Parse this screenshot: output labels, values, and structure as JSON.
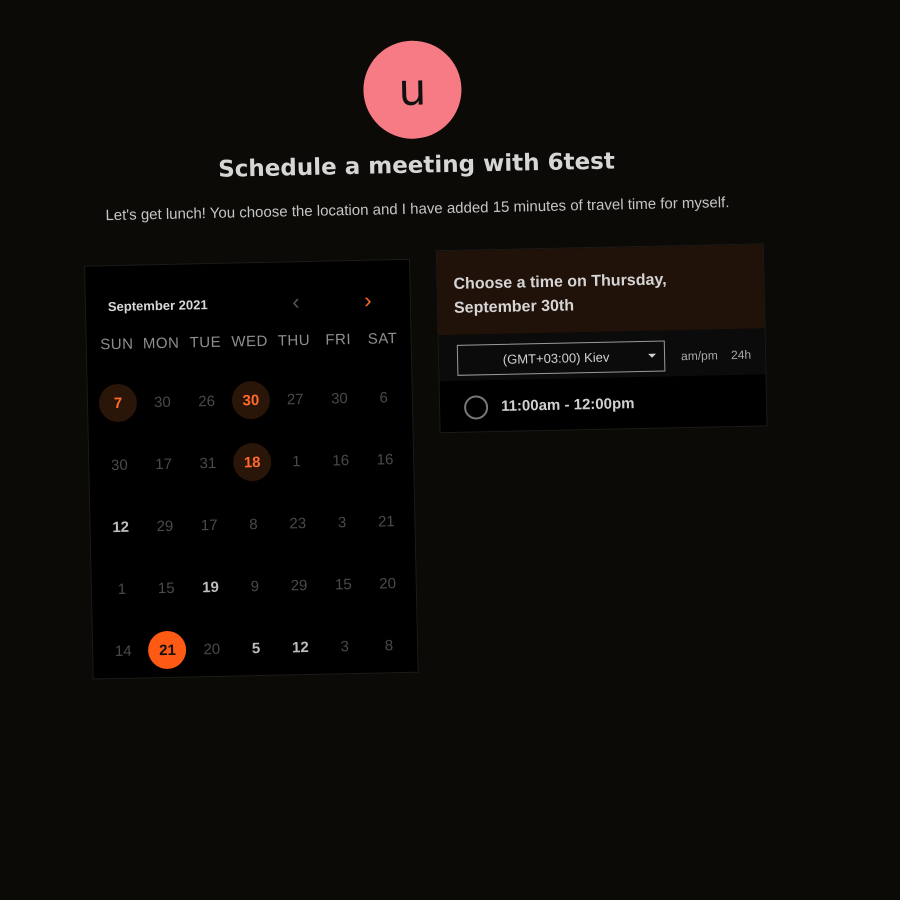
{
  "host": {
    "avatar_letter": "u",
    "avatar_color": "#f77b85"
  },
  "title": "Schedule a meeting with 6test",
  "description": "Let's get lunch! You choose the location and I have added 15 minutes of travel time for myself.",
  "calendar": {
    "month_label": "September 2021",
    "prev_icon": "chevron-left-icon",
    "next_icon": "chevron-right-icon",
    "weekdays": [
      "SUN",
      "MON",
      "TUE",
      "WED",
      "THU",
      "FRI",
      "SAT"
    ],
    "days": [
      {
        "label": "7",
        "state": "available"
      },
      {
        "label": "30",
        "state": "muted"
      },
      {
        "label": "26",
        "state": "muted"
      },
      {
        "label": "30",
        "state": "available"
      },
      {
        "label": "27",
        "state": "muted"
      },
      {
        "label": "30",
        "state": "muted"
      },
      {
        "label": "6",
        "state": "muted"
      },
      {
        "label": "30",
        "state": "muted"
      },
      {
        "label": "17",
        "state": "muted"
      },
      {
        "label": "31",
        "state": "muted"
      },
      {
        "label": "18",
        "state": "available"
      },
      {
        "label": "1",
        "state": "muted"
      },
      {
        "label": "16",
        "state": "muted"
      },
      {
        "label": "16",
        "state": "muted"
      },
      {
        "label": "12",
        "state": "bold"
      },
      {
        "label": "29",
        "state": "muted"
      },
      {
        "label": "17",
        "state": "muted"
      },
      {
        "label": "8",
        "state": "muted"
      },
      {
        "label": "23",
        "state": "muted"
      },
      {
        "label": "3",
        "state": "muted"
      },
      {
        "label": "21",
        "state": "muted"
      },
      {
        "label": "1",
        "state": "muted"
      },
      {
        "label": "15",
        "state": "muted"
      },
      {
        "label": "19",
        "state": "bold"
      },
      {
        "label": "9",
        "state": "muted"
      },
      {
        "label": "29",
        "state": "muted"
      },
      {
        "label": "15",
        "state": "muted"
      },
      {
        "label": "20",
        "state": "muted"
      },
      {
        "label": "14",
        "state": "muted"
      },
      {
        "label": "21",
        "state": "selected"
      },
      {
        "label": "20",
        "state": "muted"
      },
      {
        "label": "5",
        "state": "bold"
      },
      {
        "label": "12",
        "state": "bold"
      },
      {
        "label": "3",
        "state": "muted"
      },
      {
        "label": "8",
        "state": "muted"
      }
    ]
  },
  "timepicker": {
    "heading": "Choose a time on Thursday, September 30th",
    "timezone_value": "(GMT+03:00) Kiev",
    "format_12h": "am/pm",
    "format_24h": "24h",
    "slots": [
      "11:00am - 12:00pm"
    ]
  },
  "colors": {
    "accent": "#ff6b2b",
    "selected": "#ff5a14",
    "background": "#0c0a07"
  }
}
